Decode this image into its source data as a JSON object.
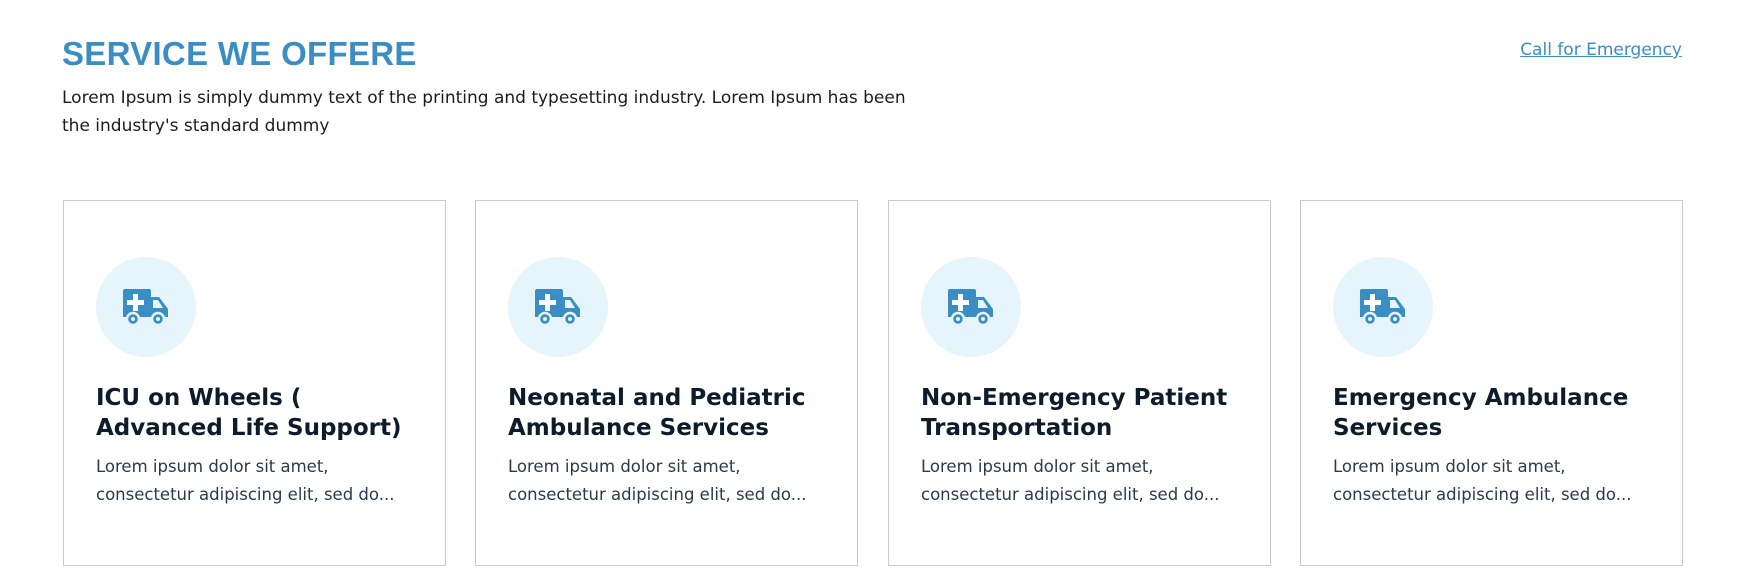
{
  "header": {
    "title": "SERVICE WE OFFERE",
    "subtitle": "Lorem Ipsum is simply dummy text of the printing and typesetting industry. Lorem Ipsum has been the industry's standard dummy",
    "emergency_link": "Call for Emergency"
  },
  "colors": {
    "accent": "#3a8ec4",
    "icon_bg": "#e6f4fb",
    "card_border": "#c9c9c9"
  },
  "services": [
    {
      "icon": "ambulance-icon",
      "title": "ICU on Wheels ( Advanced Life Support)",
      "description": "Lorem ipsum dolor sit amet, consectetur adipiscing elit, sed do..."
    },
    {
      "icon": "ambulance-icon",
      "title": "Neonatal and Pediatric Ambulance Services",
      "description": "Lorem ipsum dolor sit amet, consectetur adipiscing elit, sed do..."
    },
    {
      "icon": "ambulance-icon",
      "title": "Non-Emergency Patient Transportation",
      "description": "Lorem ipsum dolor sit amet, consectetur adipiscing elit, sed do..."
    },
    {
      "icon": "ambulance-icon",
      "title": "Emergency Ambulance Services",
      "description": "Lorem ipsum dolor sit amet, consectetur adipiscing elit, sed do..."
    }
  ]
}
